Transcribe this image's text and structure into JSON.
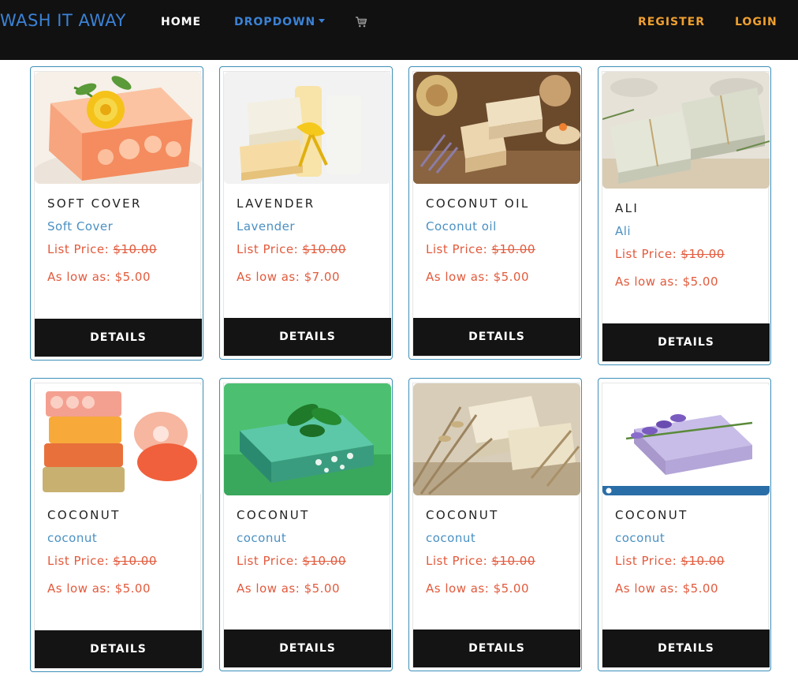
{
  "nav": {
    "brand": "WASH IT AWAY",
    "home": "HOME",
    "dropdown": "DROPDOWN",
    "register": "REGISTER",
    "login": "LOGIN"
  },
  "price_prefix": "List Price: ",
  "low_prefix": "As low as: ",
  "products": [
    {
      "name": "SOFT COVER",
      "subtitle": "Soft Cover",
      "list_price": "$10.00",
      "low_price": "$5.00",
      "button": "DETAILS"
    },
    {
      "name": "LAVENDER",
      "subtitle": "Lavender",
      "list_price": "$10.00",
      "low_price": "$7.00",
      "button": "DETAILS"
    },
    {
      "name": "COCONUT OIL",
      "subtitle": "Coconut oil",
      "list_price": "$10.00",
      "low_price": "$5.00",
      "button": "DETAILS"
    },
    {
      "name": "ALI",
      "subtitle": "Ali",
      "list_price": "$10.00",
      "low_price": "$5.00",
      "button": "DETAILS"
    },
    {
      "name": "COCONUT",
      "subtitle": "coconut",
      "list_price": "$10.00",
      "low_price": "$5.00",
      "button": "DETAILS"
    },
    {
      "name": "COCONUT",
      "subtitle": "coconut",
      "list_price": "$10.00",
      "low_price": "$5.00",
      "button": "DETAILS"
    },
    {
      "name": "COCONUT",
      "subtitle": "coconut",
      "list_price": "$10.00",
      "low_price": "$5.00",
      "button": "DETAILS"
    },
    {
      "name": "COCONUT",
      "subtitle": "coconut",
      "list_price": "$10.00",
      "low_price": "$5.00",
      "button": "DETAILS"
    }
  ]
}
